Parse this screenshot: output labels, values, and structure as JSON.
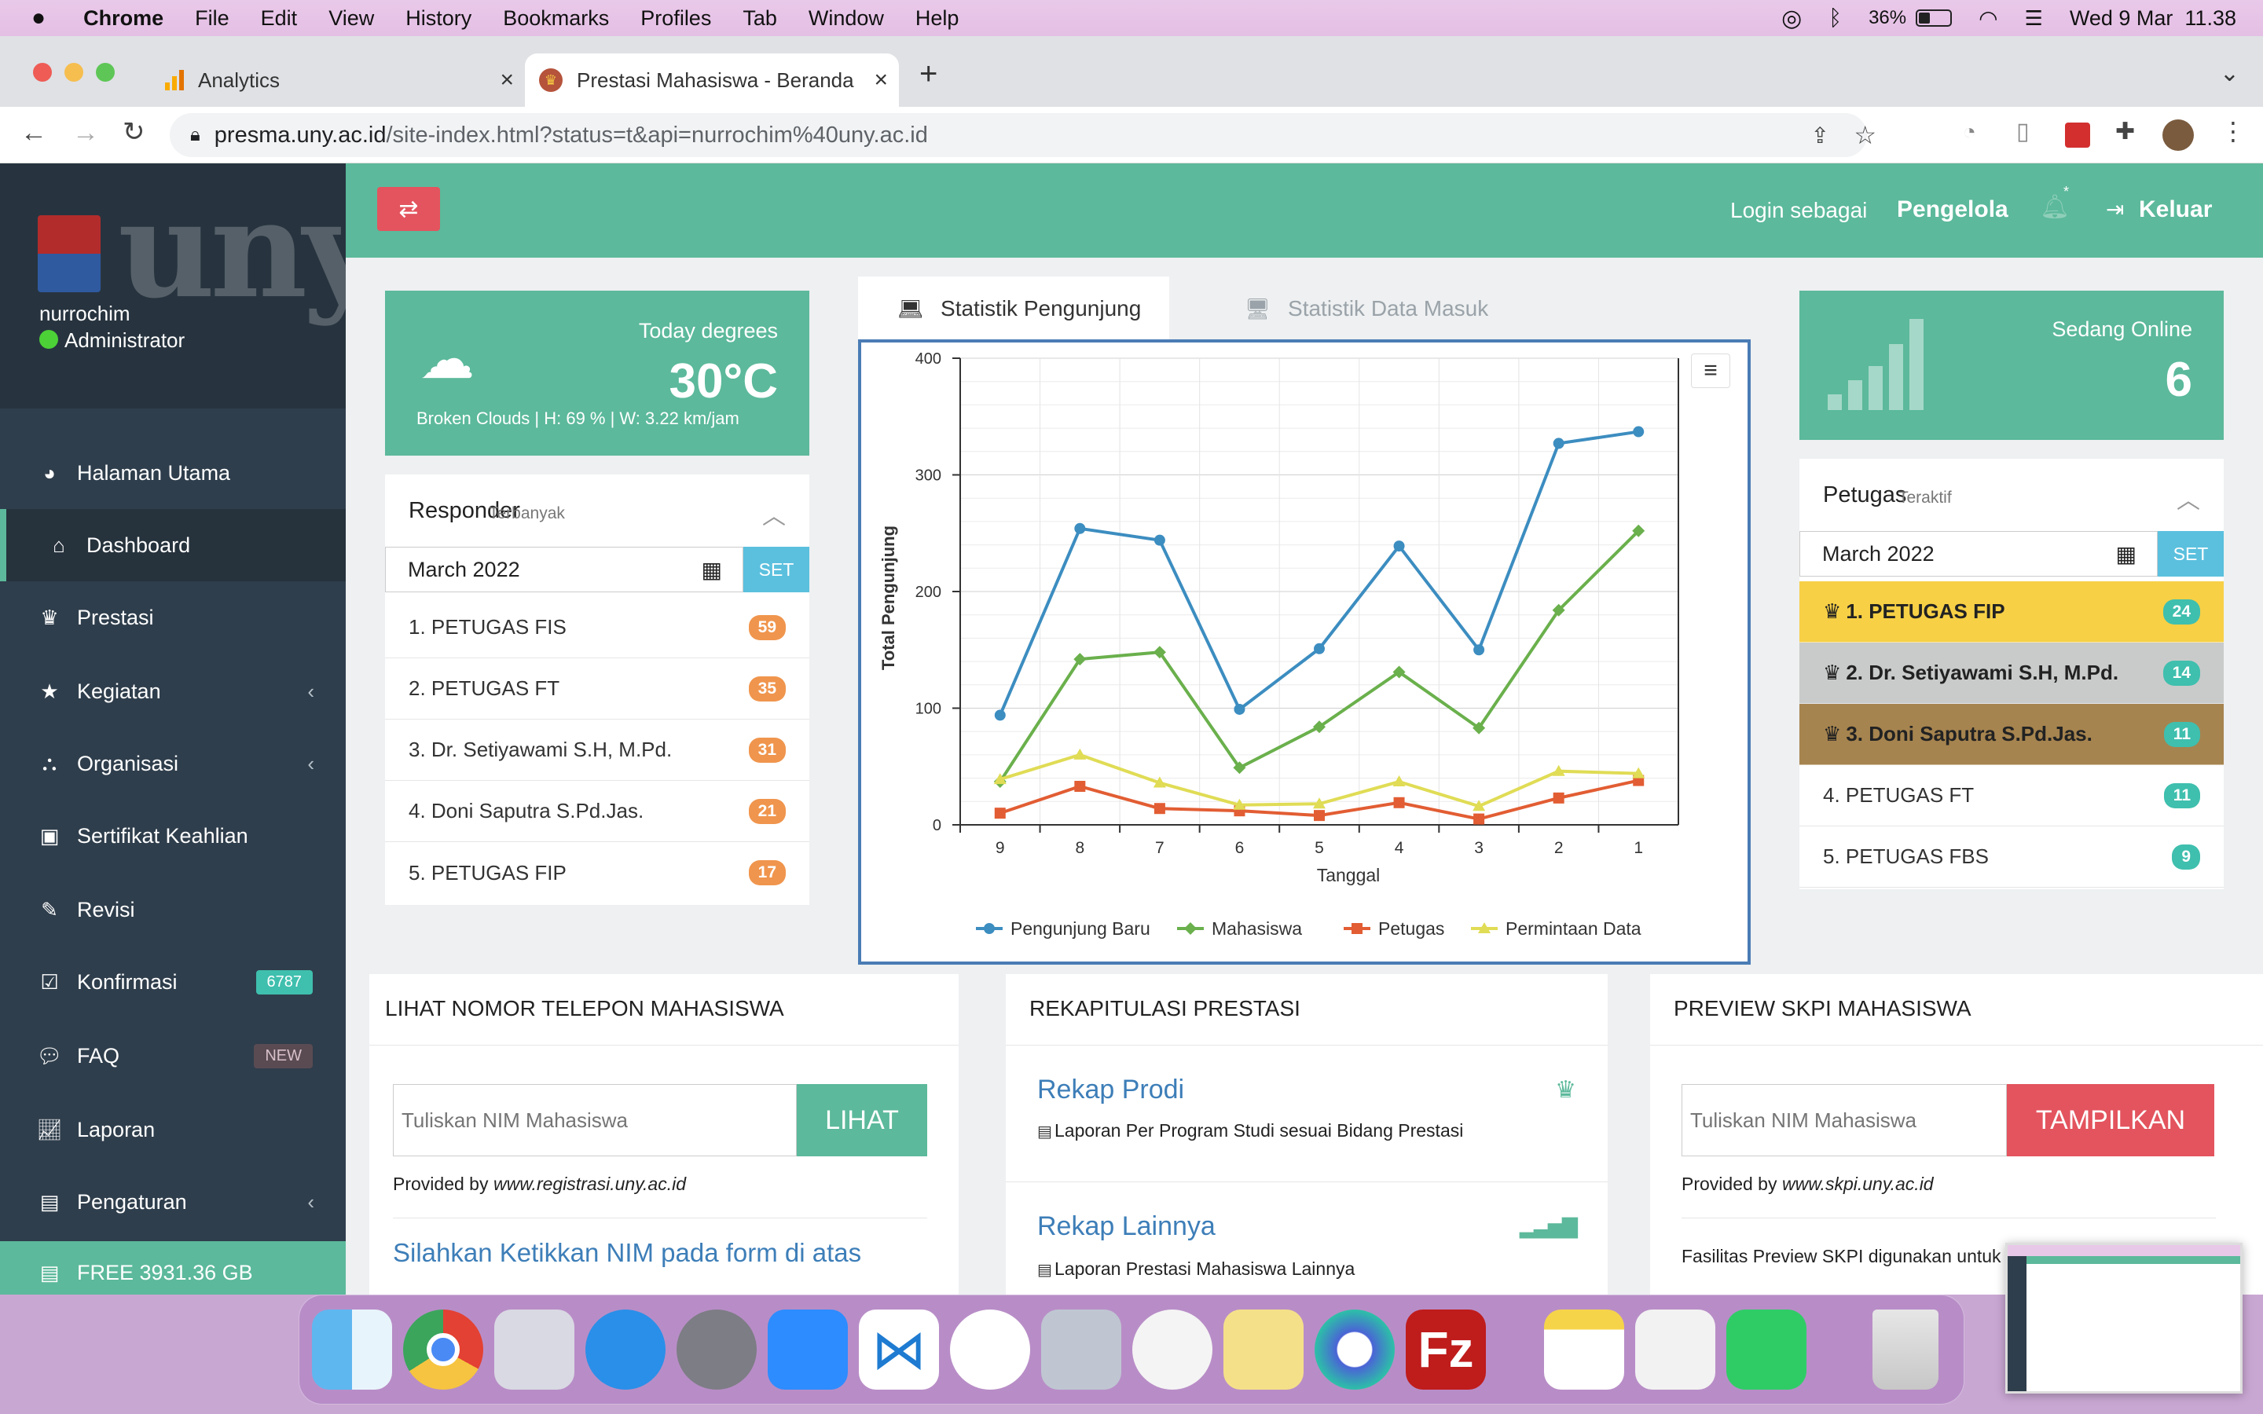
{
  "menubar": {
    "app": "Chrome",
    "items": [
      "File",
      "Edit",
      "View",
      "History",
      "Bookmarks",
      "Profiles",
      "Tab",
      "Window",
      "Help"
    ],
    "battery": "36%",
    "clock": "Wed 9 Mar  11.38"
  },
  "browser": {
    "tabs": [
      {
        "title": "Analytics",
        "active": false
      },
      {
        "title": "Prestasi Mahasiswa - Beranda",
        "active": true
      }
    ],
    "url_host": "presma.uny.ac.id",
    "url_path": "/site-index.html?status=t&api=nurrochim%40uny.ac.id"
  },
  "sidebar": {
    "user_name": "nurrochim",
    "user_role": "Administrator",
    "items": [
      {
        "label": "Halaman Utama",
        "icon": "dashboard-icon"
      },
      {
        "label": "Dashboard",
        "icon": "home-icon",
        "active": true
      },
      {
        "label": "Prestasi",
        "icon": "trophy-icon"
      },
      {
        "label": "Kegiatan",
        "icon": "star-icon"
      },
      {
        "label": "Organisasi",
        "icon": "sitemap-icon"
      },
      {
        "label": "Sertifikat Keahlian",
        "icon": "certificate-icon"
      },
      {
        "label": "Revisi",
        "icon": "edit-icon"
      },
      {
        "label": "Konfirmasi",
        "icon": "check-icon",
        "badge": "6787"
      },
      {
        "label": "FAQ",
        "icon": "comments-icon",
        "badge": "NEW"
      },
      {
        "label": "Laporan",
        "icon": "line-chart-icon"
      },
      {
        "label": "Pengaturan",
        "icon": "settings-list-icon"
      }
    ],
    "storage": "FREE 3931.36 GB"
  },
  "topbar": {
    "login_as": "Login sebagai",
    "role": "Pengelola",
    "logout": "Keluar"
  },
  "weather": {
    "label": "Today degrees",
    "temp": "30°C",
    "detail": "Broken Clouds | H: 69 % | W: 3.22 km/jam"
  },
  "responder": {
    "title": "Responder",
    "subtitle": "Terbanyak",
    "month": "March",
    "year": "2022",
    "set": "SET",
    "items": [
      {
        "label": "1. PETUGAS FIS",
        "count": "59"
      },
      {
        "label": "2. PETUGAS FT",
        "count": "35"
      },
      {
        "label": "3. Dr. Setiyawami S.H, M.Pd.",
        "count": "31"
      },
      {
        "label": "4. Doni Saputra S.Pd.Jas.",
        "count": "21"
      },
      {
        "label": "5. PETUGAS FIP",
        "count": "17"
      }
    ]
  },
  "chart_tabs": [
    "Statistik Pengunjung",
    "Statistik Data Masuk"
  ],
  "chart_data": {
    "type": "line",
    "xlabel": "Tanggal",
    "ylabel": "Total Pengunjung",
    "categories": [
      "9",
      "8",
      "7",
      "6",
      "5",
      "4",
      "3",
      "2",
      "1"
    ],
    "ylim": [
      0,
      400
    ],
    "yticks": [
      "0",
      "100",
      "200",
      "300",
      "400"
    ],
    "grid": true,
    "legend": "bottom",
    "series": [
      {
        "name": "Pengunjung Baru",
        "color": "#3c8dc0",
        "marker": "circle",
        "values": [
          94,
          254,
          244,
          99,
          151,
          239,
          150,
          327,
          337
        ]
      },
      {
        "name": "Mahasiswa",
        "color": "#6ab04c",
        "marker": "diamond",
        "values": [
          37,
          142,
          148,
          49,
          84,
          131,
          83,
          184,
          252
        ]
      },
      {
        "name": "Petugas",
        "color": "#e25d33",
        "marker": "square",
        "values": [
          10,
          33,
          14,
          12,
          8,
          19,
          5,
          23,
          38
        ]
      },
      {
        "name": "Permintaan Data",
        "color": "#e0dc55",
        "marker": "triangle",
        "values": [
          39,
          60,
          36,
          17,
          18,
          37,
          16,
          46,
          44
        ]
      }
    ]
  },
  "online": {
    "label": "Sedang Online",
    "count": "6"
  },
  "petugas": {
    "title": "Petugas",
    "subtitle": "Teraktif",
    "month": "March",
    "year": "2022",
    "set": "SET",
    "items": [
      {
        "label": "1. PETUGAS FIP",
        "count": "24",
        "bg": "#f7d046",
        "fg": "#222",
        "trophy": true
      },
      {
        "label": "2. Dr. Setiyawami S.H, M.Pd.",
        "count": "14",
        "bg": "#c9cbca",
        "fg": "#222",
        "trophy": true
      },
      {
        "label": "3. Doni Saputra S.Pd.Jas.",
        "count": "11",
        "bg": "#a6844f",
        "fg": "#222",
        "trophy": true
      },
      {
        "label": "4. PETUGAS FT",
        "count": "11",
        "bg": "#ffffff",
        "fg": "#333",
        "trophy": false
      },
      {
        "label": "5. PETUGAS FBS",
        "count": "9",
        "bg": "#ffffff",
        "fg": "#333",
        "trophy": false
      }
    ]
  },
  "telepon": {
    "title": "LIHAT NOMOR TELEPON MAHASISWA",
    "placeholder": "Tuliskan NIM Mahasiswa",
    "button": "LIHAT",
    "provided_by": "Provided by",
    "provider": "www.registrasi.uny.ac.id",
    "hint": "Silahkan Ketikkan NIM pada form di atas"
  },
  "rekap": {
    "title": "REKAPITULASI PRESTASI",
    "items": [
      {
        "title": "Rekap Prodi",
        "desc": "Laporan Per Program Studi sesuai Bidang Prestasi",
        "icon": "trophy-icon"
      },
      {
        "title": "Rekap Lainnya",
        "desc": "Laporan Prestasi Mahasiswa Lainnya",
        "icon": "signal-icon"
      }
    ]
  },
  "skpi": {
    "title": "PREVIEW SKPI MAHASISWA",
    "placeholder": "Tuliskan NIM Mahasiswa",
    "button": "TAMPILKAN",
    "provided_by": "Provided by",
    "provider": "www.skpi.uny.ac.id",
    "note": "Fasilitas Preview SKPI digunakan untuk m"
  }
}
